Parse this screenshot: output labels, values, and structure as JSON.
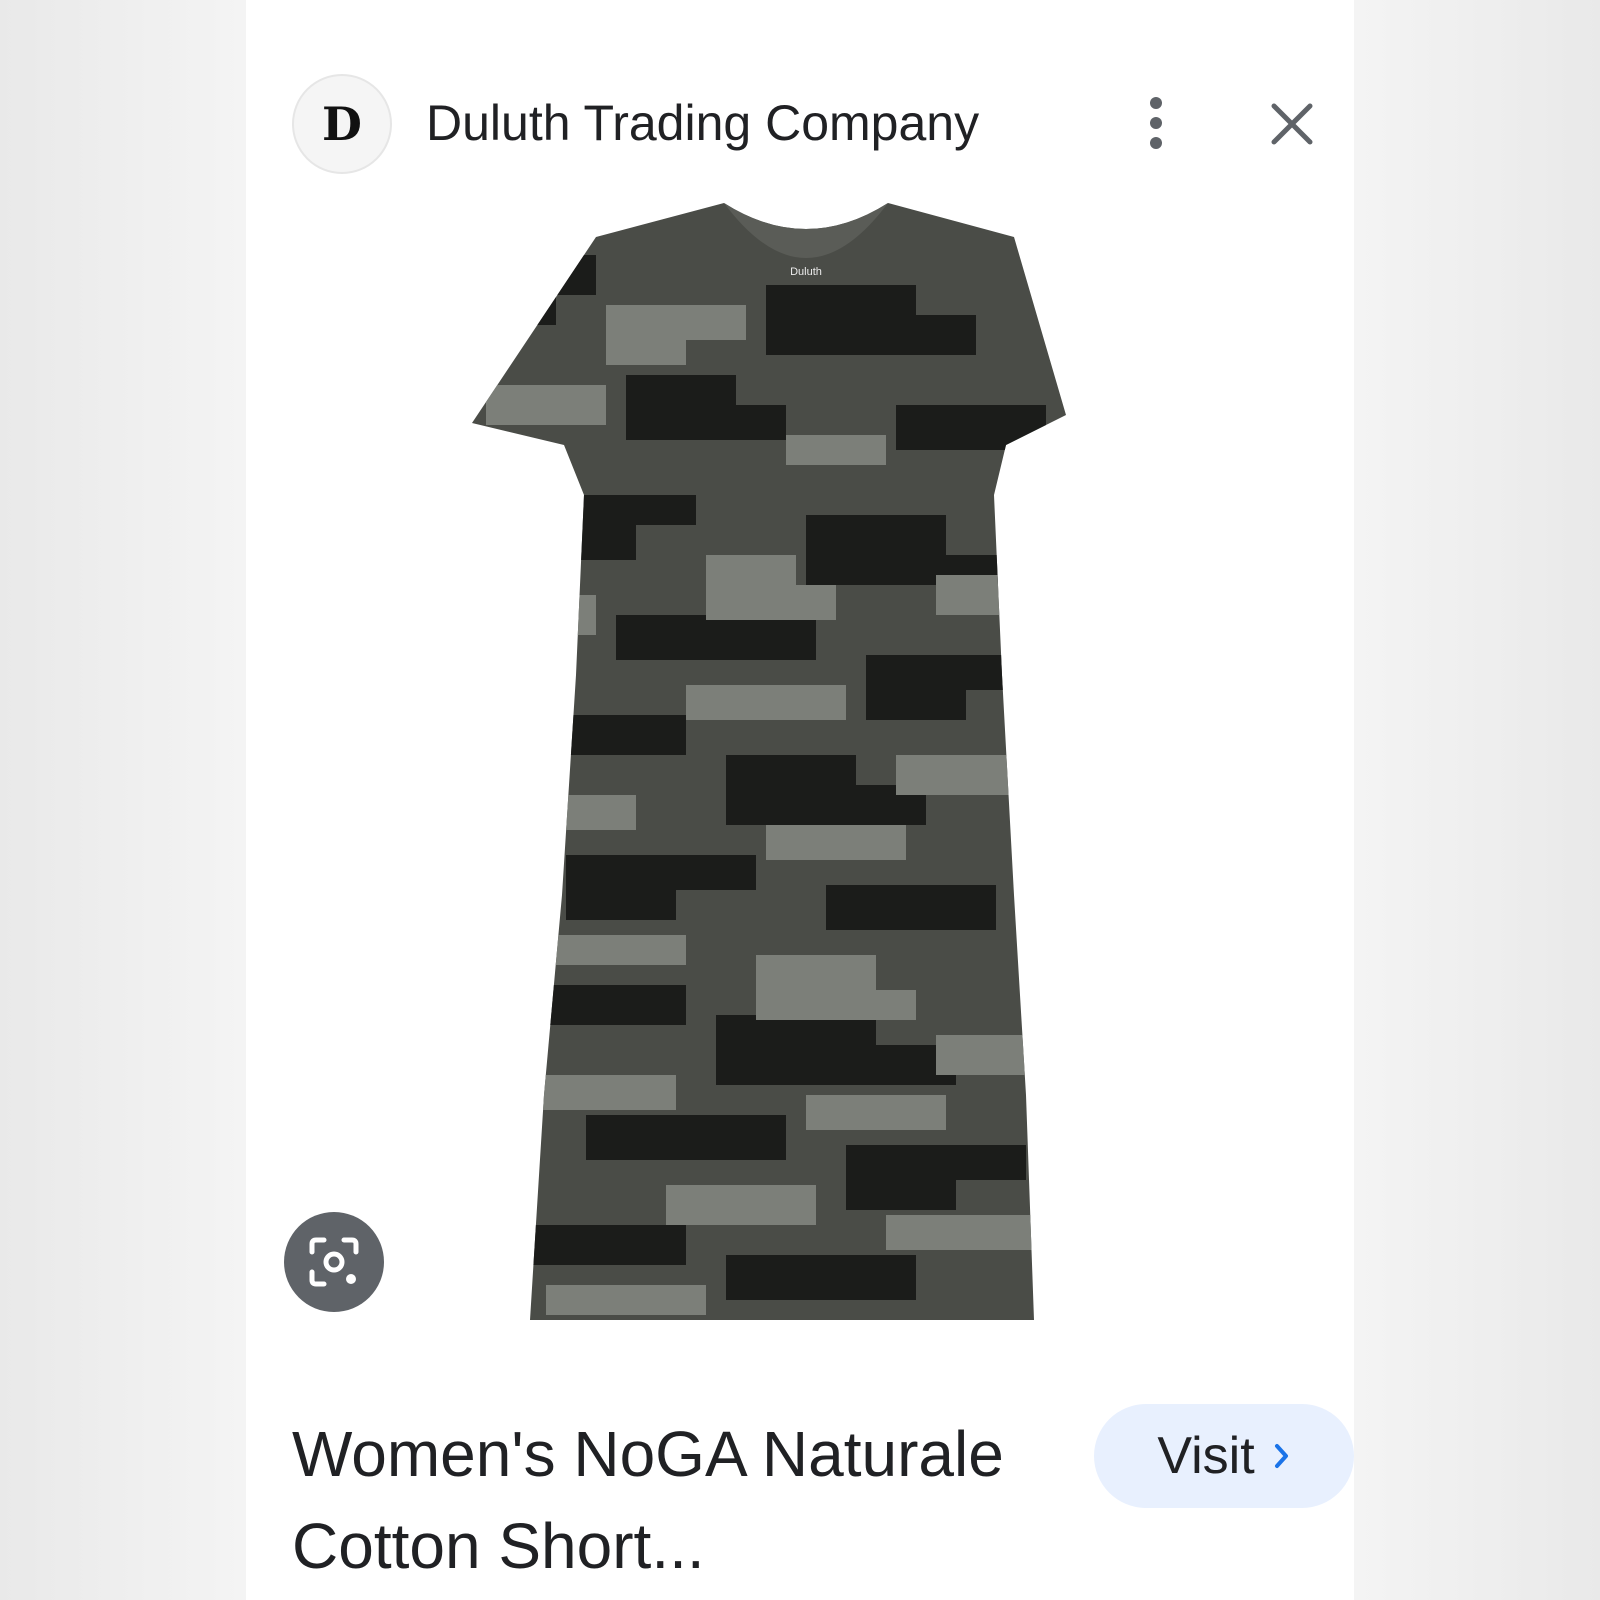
{
  "source": {
    "logo_letter": "D",
    "name": "Duluth Trading Company"
  },
  "icons": {
    "more": "more-vert-icon",
    "close": "close-icon",
    "lens": "lens-icon",
    "chevron": "chevron-right-icon"
  },
  "product": {
    "image_alt": "camouflage short-sleeve v-neck dress",
    "garment_tag": "Duluth",
    "title": "Women's NoGA Naturale Cotton Short..."
  },
  "actions": {
    "visit_label": "Visit"
  },
  "colors": {
    "visit_bg": "#e8f0fe",
    "visit_chevron": "#1a73e8",
    "camo_dark": "#1b1c1a",
    "camo_mid": "#4a4c47",
    "camo_light": "#7c7f79"
  }
}
